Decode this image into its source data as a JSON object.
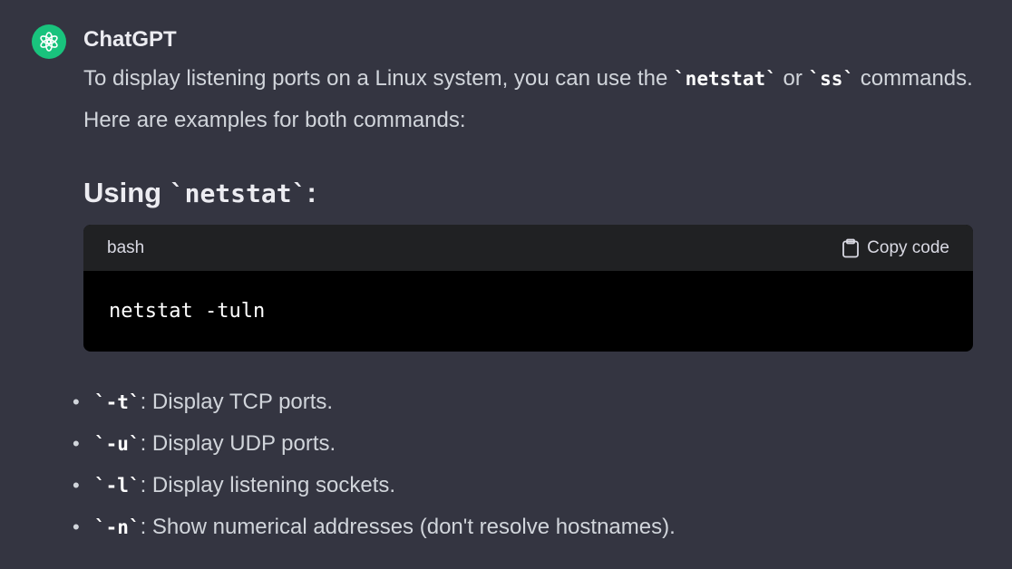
{
  "message": {
    "author": "ChatGPT",
    "intro_before": "To display listening ports on a Linux system, you can use the ",
    "cmd1": "`netstat`",
    "intro_or": " or ",
    "cmd2": "`ss`",
    "intro_after": " commands. Here are examples for both commands:"
  },
  "section": {
    "heading_prefix": "Using ",
    "heading_code": "`netstat`",
    "heading_suffix": ":"
  },
  "codeblock": {
    "language": "bash",
    "copy_label": "Copy code",
    "code": "netstat -tuln"
  },
  "bullets": [
    {
      "flag": "`-t`",
      "text": ": Display TCP ports."
    },
    {
      "flag": "`-u`",
      "text": ": Display UDP ports."
    },
    {
      "flag": "`-l`",
      "text": ": Display listening sockets."
    },
    {
      "flag": "`-n`",
      "text": ": Show numerical addresses (don't resolve hostnames)."
    }
  ],
  "colors": {
    "background": "#343541",
    "avatar": "#19c37d",
    "code_background": "#000000",
    "code_header": "#202123"
  },
  "icons": [
    "chatgpt-logo-icon",
    "clipboard-icon"
  ]
}
